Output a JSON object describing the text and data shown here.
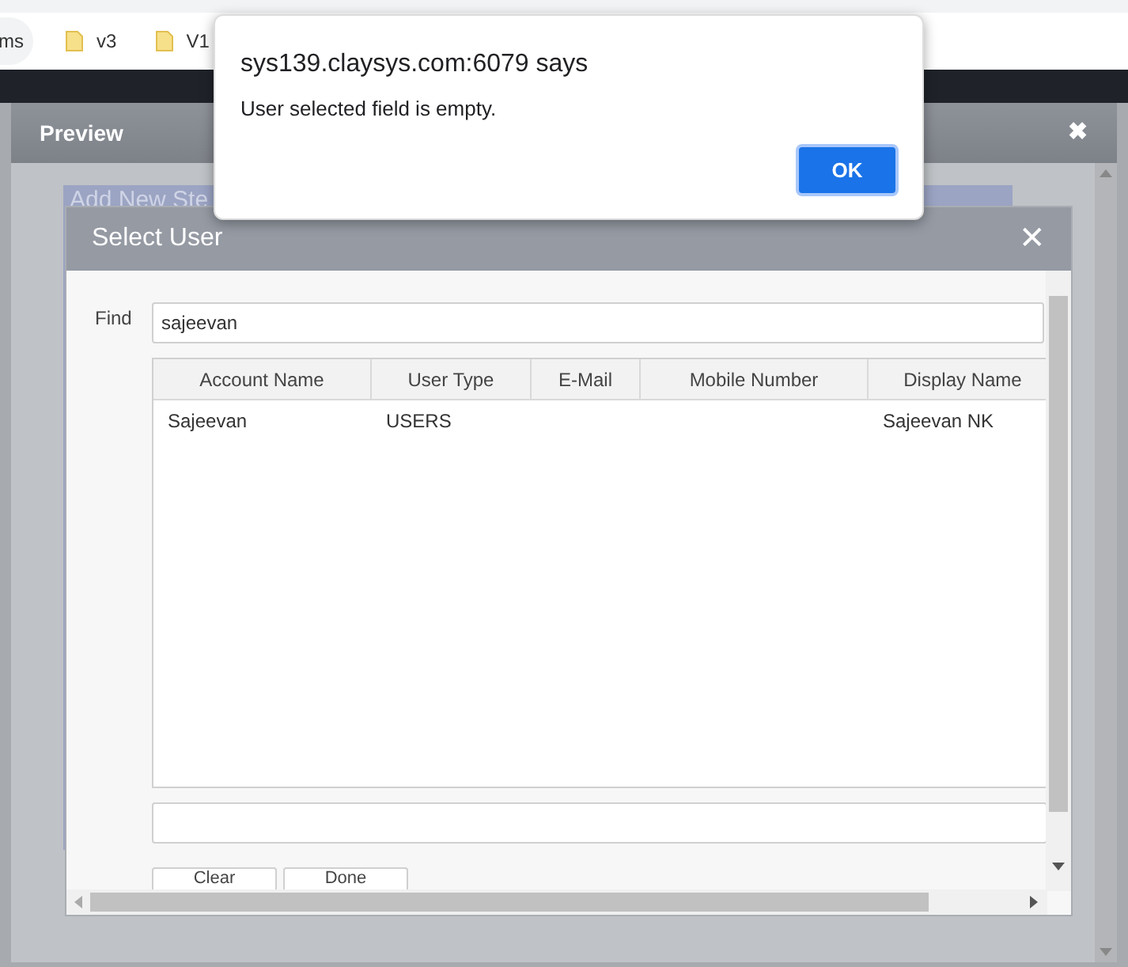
{
  "bookmarks_bar": {
    "items": [
      {
        "label": "ms",
        "kind": "chip"
      },
      {
        "label": "v3",
        "kind": "folder"
      },
      {
        "label": "V1",
        "kind": "folder"
      }
    ]
  },
  "preview_dialog": {
    "title": "Preview",
    "close": "✖",
    "background_panel": {
      "title": "Add New Ste"
    }
  },
  "select_user_dialog": {
    "title": "Select User",
    "close": "✕",
    "find_label": "Find",
    "find_value": "sajeevan",
    "table": {
      "columns": [
        "Account Name",
        "User Type",
        "E-Mail",
        "Mobile Number",
        "Display Name"
      ],
      "rows": [
        [
          "Sajeevan",
          "USERS",
          "",
          "",
          "Sajeevan NK"
        ]
      ]
    },
    "buttons": [
      "Clear",
      "Done"
    ]
  },
  "alert": {
    "title": "sys139.claysys.com:6079 says",
    "message": "User selected field is empty.",
    "button": "OK"
  }
}
